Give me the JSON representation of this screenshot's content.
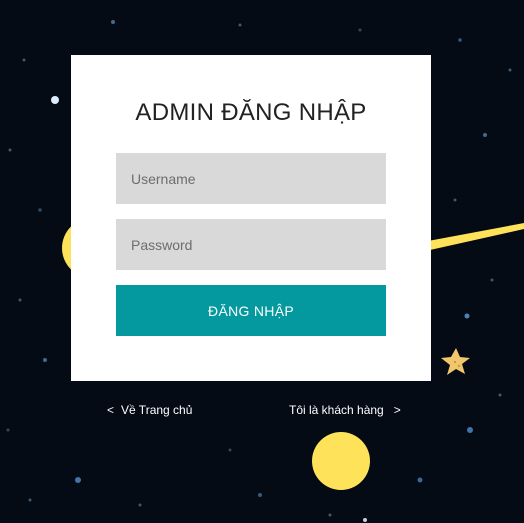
{
  "login": {
    "title": "ADMIN ĐĂNG NHẬP",
    "username_placeholder": "Username",
    "password_placeholder": "Password",
    "submit_label": "ĐĂNG NHẬP"
  },
  "links": {
    "home_arrow": "<",
    "home_label": "Về Trang chủ",
    "customer_label": "Tôi là khách hàng",
    "customer_arrow": ">"
  },
  "colors": {
    "background": "#050b14",
    "card": "#ffffff",
    "input_bg": "#d9d9d9",
    "button": "#04999f",
    "accent_yellow": "#fde25a",
    "star": "#f2c76b"
  }
}
